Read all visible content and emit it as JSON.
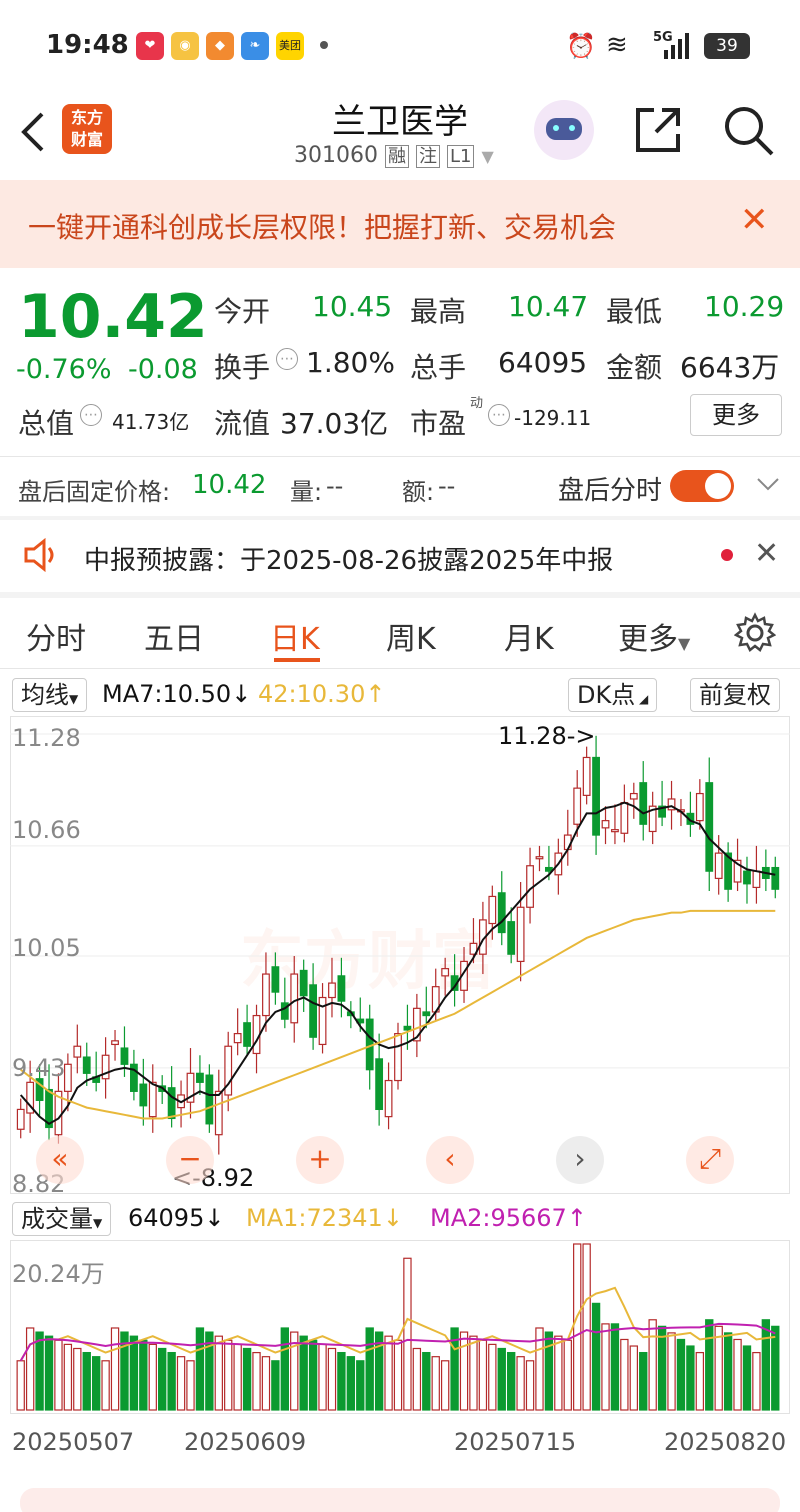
{
  "status_bar": {
    "time": "19:48",
    "apps": [
      "health-app-icon",
      "weibo-icon",
      "deals-app-icon",
      "feather-app-icon",
      "meituan-icon"
    ],
    "meituan_label": "美团",
    "network": "5G",
    "battery": "39"
  },
  "nav": {
    "logo_line1": "东方",
    "logo_line2": "财富",
    "stock_name": "兰卫医学",
    "stock_code": "301060",
    "tags": [
      "融",
      "注",
      "L1"
    ]
  },
  "banner": {
    "text": "一键开通科创成长层权限！把握打新、交易机会"
  },
  "quote": {
    "price": "10.42",
    "change_pct": "-0.76%",
    "change_abs": "-0.08",
    "open_label": "今开",
    "open": "10.45",
    "high_label": "最高",
    "high": "10.47",
    "low_label": "最低",
    "low": "10.29",
    "turnover_label": "换手",
    "turnover": "1.80%",
    "volume_label": "总手",
    "volume": "64095",
    "amount_label": "金额",
    "amount": "6643万",
    "mktcap_label": "总值",
    "mktcap": "41.73亿",
    "float_label": "流值",
    "float_cap": "37.03亿",
    "pe_label": "市盈",
    "pe_sup": "动",
    "pe": "-129.11",
    "more": "更多"
  },
  "after_hours": {
    "price_label": "盘后固定价格:",
    "price": "10.42",
    "vol_label": "量:",
    "vol": "--",
    "amt_label": "额:",
    "amt": "--",
    "toggle_label": "盘后分时",
    "toggle_on": true
  },
  "notice": {
    "text": "中报预披露：于2025-08-26披露2025年中报"
  },
  "tabs": [
    "分时",
    "五日",
    "日K",
    "周K",
    "月K",
    "更多"
  ],
  "active_tab": 2,
  "kline_bar": {
    "ma_selector": "均线",
    "ma7": "MA7:10.50",
    "ma7_arrow": "↓",
    "ma42": "42:10.30",
    "ma42_arrow": "↑",
    "dk": "DK点",
    "adjust": "前复权"
  },
  "price_axis": [
    "11.28",
    "10.66",
    "10.05",
    "9.43",
    "8.82"
  ],
  "annotations": {
    "high_mark": "11.28->",
    "low_mark": "<-8.92"
  },
  "volume_bar": {
    "selector": "成交量",
    "value": "64095",
    "value_arrow": "↓",
    "ma1": "MA1:72341",
    "ma1_arrow": "↓",
    "ma2": "MA2:95667",
    "ma2_arrow": "↑",
    "max_label": "20.24万"
  },
  "date_axis": [
    "20250507",
    "20250609",
    "20250715",
    "20250820"
  ],
  "colors": {
    "up": "#b42a2a",
    "down": "#0b9a30",
    "accent": "#e8541c",
    "ma7": "#111111",
    "ma42": "#e8b83a",
    "ma2": "#c020b0"
  },
  "chart_data": {
    "type": "candlestick",
    "y_range": [
      8.82,
      11.28
    ],
    "closes": [
      9.2,
      9.35,
      9.25,
      9.1,
      9.3,
      9.45,
      9.55,
      9.4,
      9.35,
      9.5,
      9.58,
      9.45,
      9.3,
      9.22,
      9.35,
      9.3,
      9.15,
      9.28,
      9.4,
      9.35,
      9.12,
      9.3,
      9.55,
      9.62,
      9.55,
      9.72,
      9.95,
      9.85,
      9.7,
      9.95,
      9.83,
      9.6,
      9.82,
      9.9,
      9.8,
      9.72,
      9.68,
      9.42,
      9.2,
      9.36,
      9.62,
      9.64,
      9.76,
      9.72,
      9.88,
      9.98,
      9.86,
      10.02,
      10.12,
      10.25,
      10.38,
      10.18,
      10.06,
      10.32,
      10.55,
      10.6,
      10.52,
      10.62,
      10.72,
      10.98,
      11.15,
      10.72,
      10.8,
      10.75,
      10.9,
      10.95,
      10.78,
      10.88,
      10.82,
      10.92,
      10.86,
      10.78,
      10.95,
      10.52,
      10.62,
      10.42,
      10.58,
      10.45,
      10.52,
      10.48,
      10.42
    ],
    "ma7": [
      9.28,
      9.22,
      9.16,
      9.12,
      9.15,
      9.22,
      9.32,
      9.36,
      9.38,
      9.4,
      9.42,
      9.43,
      9.42,
      9.38,
      9.34,
      9.32,
      9.27,
      9.24,
      9.27,
      9.3,
      9.28,
      9.28,
      9.34,
      9.42,
      9.5,
      9.58,
      9.68,
      9.74,
      9.76,
      9.8,
      9.82,
      9.79,
      9.77,
      9.79,
      9.78,
      9.74,
      9.66,
      9.6,
      9.56,
      9.54,
      9.55,
      9.57,
      9.6,
      9.67,
      9.74,
      9.82,
      9.88,
      9.96,
      10.04,
      10.14,
      10.2,
      10.24,
      10.3,
      10.36,
      10.42,
      10.46,
      10.5,
      10.56,
      10.64,
      10.75,
      10.84,
      10.84,
      10.87,
      10.88,
      10.9,
      10.88,
      10.84,
      10.86,
      10.87,
      10.88,
      10.85,
      10.8,
      10.78,
      10.7,
      10.65,
      10.6,
      10.56,
      10.53,
      10.52,
      10.51,
      10.5
    ],
    "ma42": [
      9.42,
      9.38,
      9.34,
      9.3,
      9.27,
      9.25,
      9.23,
      9.21,
      9.2,
      9.19,
      9.18,
      9.17,
      9.16,
      9.15,
      9.15,
      9.15,
      9.16,
      9.17,
      9.18,
      9.19,
      9.21,
      9.23,
      9.25,
      9.27,
      9.29,
      9.31,
      9.33,
      9.35,
      9.37,
      9.39,
      9.41,
      9.43,
      9.45,
      9.47,
      9.49,
      9.51,
      9.53,
      9.55,
      9.57,
      9.59,
      9.61,
      9.63,
      9.65,
      9.67,
      9.69,
      9.71,
      9.73,
      9.76,
      9.79,
      9.82,
      9.85,
      9.88,
      9.91,
      9.94,
      9.97,
      10.0,
      10.03,
      10.06,
      10.09,
      10.12,
      10.15,
      10.17,
      10.19,
      10.21,
      10.23,
      10.25,
      10.26,
      10.27,
      10.28,
      10.29,
      10.29,
      10.3,
      10.3,
      10.3,
      10.3,
      10.3,
      10.3,
      10.3,
      10.3,
      10.3,
      10.3
    ],
    "volume_max": 202400,
    "volume_ticks": [
      "20.24万"
    ]
  }
}
